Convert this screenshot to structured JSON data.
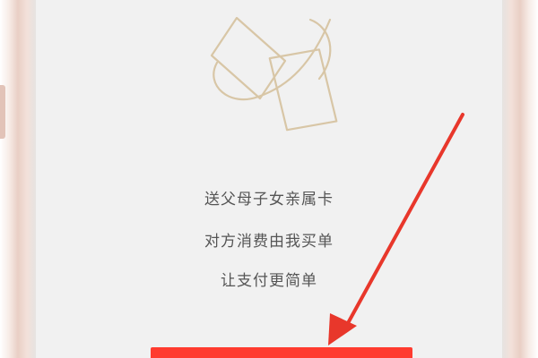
{
  "promo": {
    "lines": [
      "送父母子女亲属卡",
      "对方消费由我买单",
      "让支付更简单"
    ]
  },
  "cta": {
    "label": ""
  },
  "colors": {
    "accent": "#ff3b2f",
    "arrow": "#e8372b",
    "illustration": "#d8c6a6",
    "screen_bg": "#f1f1f1",
    "frame": "#e9cfc5"
  },
  "icons": {
    "illustration": "card-gift-icon",
    "pointer": "red-arrow-annotation"
  }
}
